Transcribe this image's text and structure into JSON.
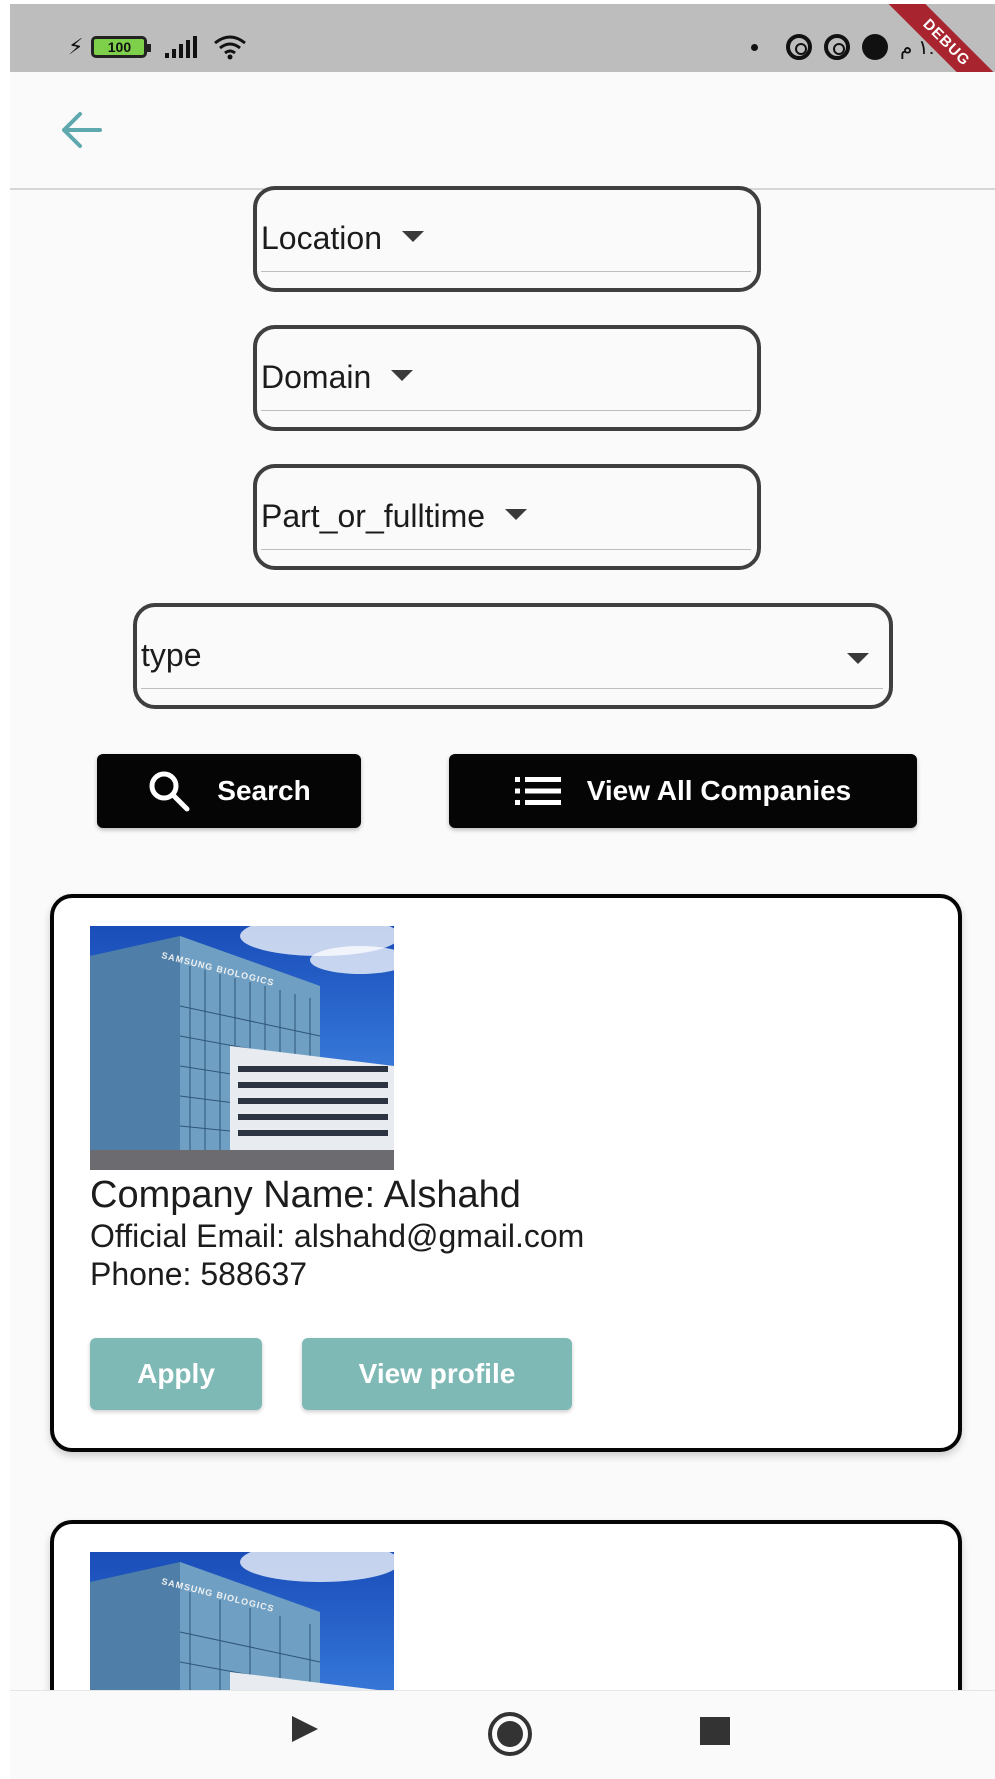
{
  "status_bar": {
    "battery": "100",
    "time": "١:٠ م",
    "debug_banner": "DEBUG"
  },
  "app_bar": {
    "back_icon": "arrow-left-icon",
    "accent_color": "#5fa8ad"
  },
  "filters": {
    "location": "Location",
    "domain": "Domain",
    "part_or_fulltime": "Part_or_fulltime",
    "type": "type"
  },
  "actions": {
    "search_label": "Search",
    "search_icon": "search-icon",
    "view_all_label": "View All Companies",
    "view_all_icon": "list-icon"
  },
  "companies": [
    {
      "name_line": "Company Name: Alshahd",
      "email_line": "Official Email: alshahd@gmail.com",
      "phone_line": "Phone: 588637",
      "apply_label": "Apply",
      "view_profile_label": "View profile",
      "photo_sign": "SAMSUNG BIOLOGICS"
    },
    {
      "photo_sign": "SAMSUNG BIOLOGICS"
    }
  ],
  "colors": {
    "button_dark": "#050505",
    "button_teal": "#7fb9b6",
    "status_bar": "#bdbdbd",
    "debug_ribbon": "#a8242e"
  },
  "nav_bar": {
    "back_icon": "triangle-play-icon",
    "home_icon": "circle-home-icon",
    "recents_icon": "square-recents-icon"
  }
}
